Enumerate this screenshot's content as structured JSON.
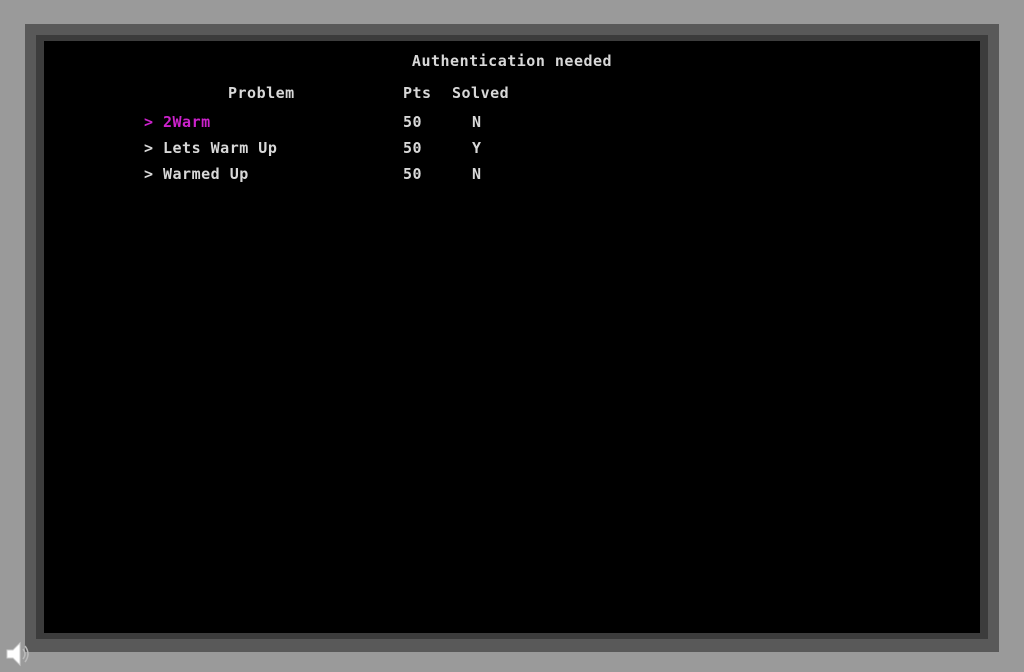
{
  "screen": {
    "title": "Authentication needed"
  },
  "table": {
    "headers": {
      "problem": "Problem",
      "pts": "Pts",
      "solved": "Solved"
    },
    "cursor_glyph": ">",
    "rows": [
      {
        "name": "2Warm",
        "pts": "50",
        "solved": "N",
        "selected": true
      },
      {
        "name": "Lets Warm Up",
        "pts": "50",
        "solved": "Y",
        "selected": false
      },
      {
        "name": "Warmed Up",
        "pts": "50",
        "solved": "N",
        "selected": false
      }
    ]
  },
  "colors": {
    "selected_text": "#cc22cc",
    "normal_text": "#d8d8d8",
    "screen_bg": "#000000",
    "bezel": "#595959",
    "desktop": "#9a9a9a"
  },
  "icons": {
    "speaker": "speaker-icon"
  }
}
